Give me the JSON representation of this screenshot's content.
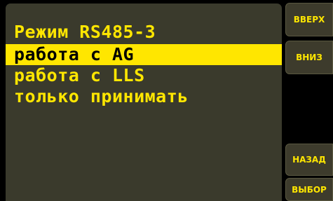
{
  "menu": {
    "title": "Режим RS485-3",
    "items": [
      {
        "label": "работа с AG",
        "selected": true
      },
      {
        "label": "работа с LLS",
        "selected": false
      },
      {
        "label": "только принимать",
        "selected": false
      }
    ]
  },
  "buttons": {
    "up": "ВВЕРХ",
    "down": "ВНИЗ",
    "back": "НАЗАД",
    "select": "ВЫБОР"
  },
  "colors": {
    "screen_background": "#3a3a2c",
    "text": "#ffe600",
    "highlight": "#ffe600",
    "highlight_text": "#000000",
    "bezel": "#000000"
  }
}
